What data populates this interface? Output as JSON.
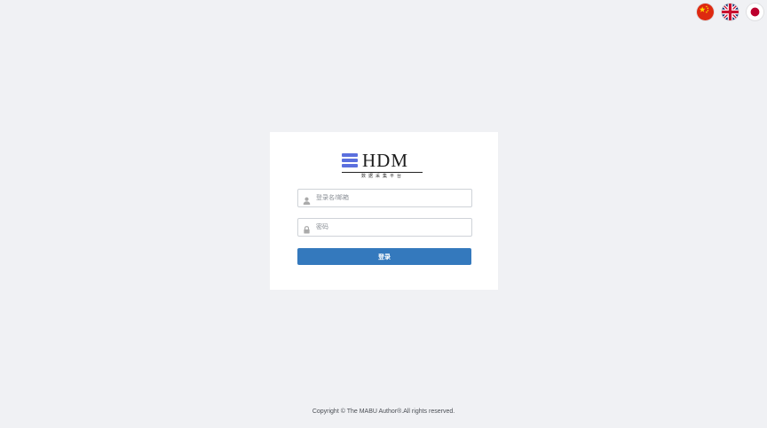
{
  "languages": [
    {
      "name": "Chinese",
      "icon": "china-flag-icon"
    },
    {
      "name": "English",
      "icon": "uk-flag-icon"
    },
    {
      "name": "Japanese",
      "icon": "japan-flag-icon"
    }
  ],
  "logo": {
    "title": "HDM",
    "subtitle": "数据采集平台",
    "accent_color": "#5b6fde"
  },
  "form": {
    "username": {
      "placeholder": "登录名/邮箱",
      "value": "",
      "icon": "user-icon"
    },
    "password": {
      "placeholder": "密码",
      "value": "",
      "icon": "lock-icon"
    },
    "submit_label": "登录",
    "submit_color": "#3479bd"
  },
  "footer": {
    "copyright": "Copyright © The MABU Author®.All rights reserved."
  }
}
